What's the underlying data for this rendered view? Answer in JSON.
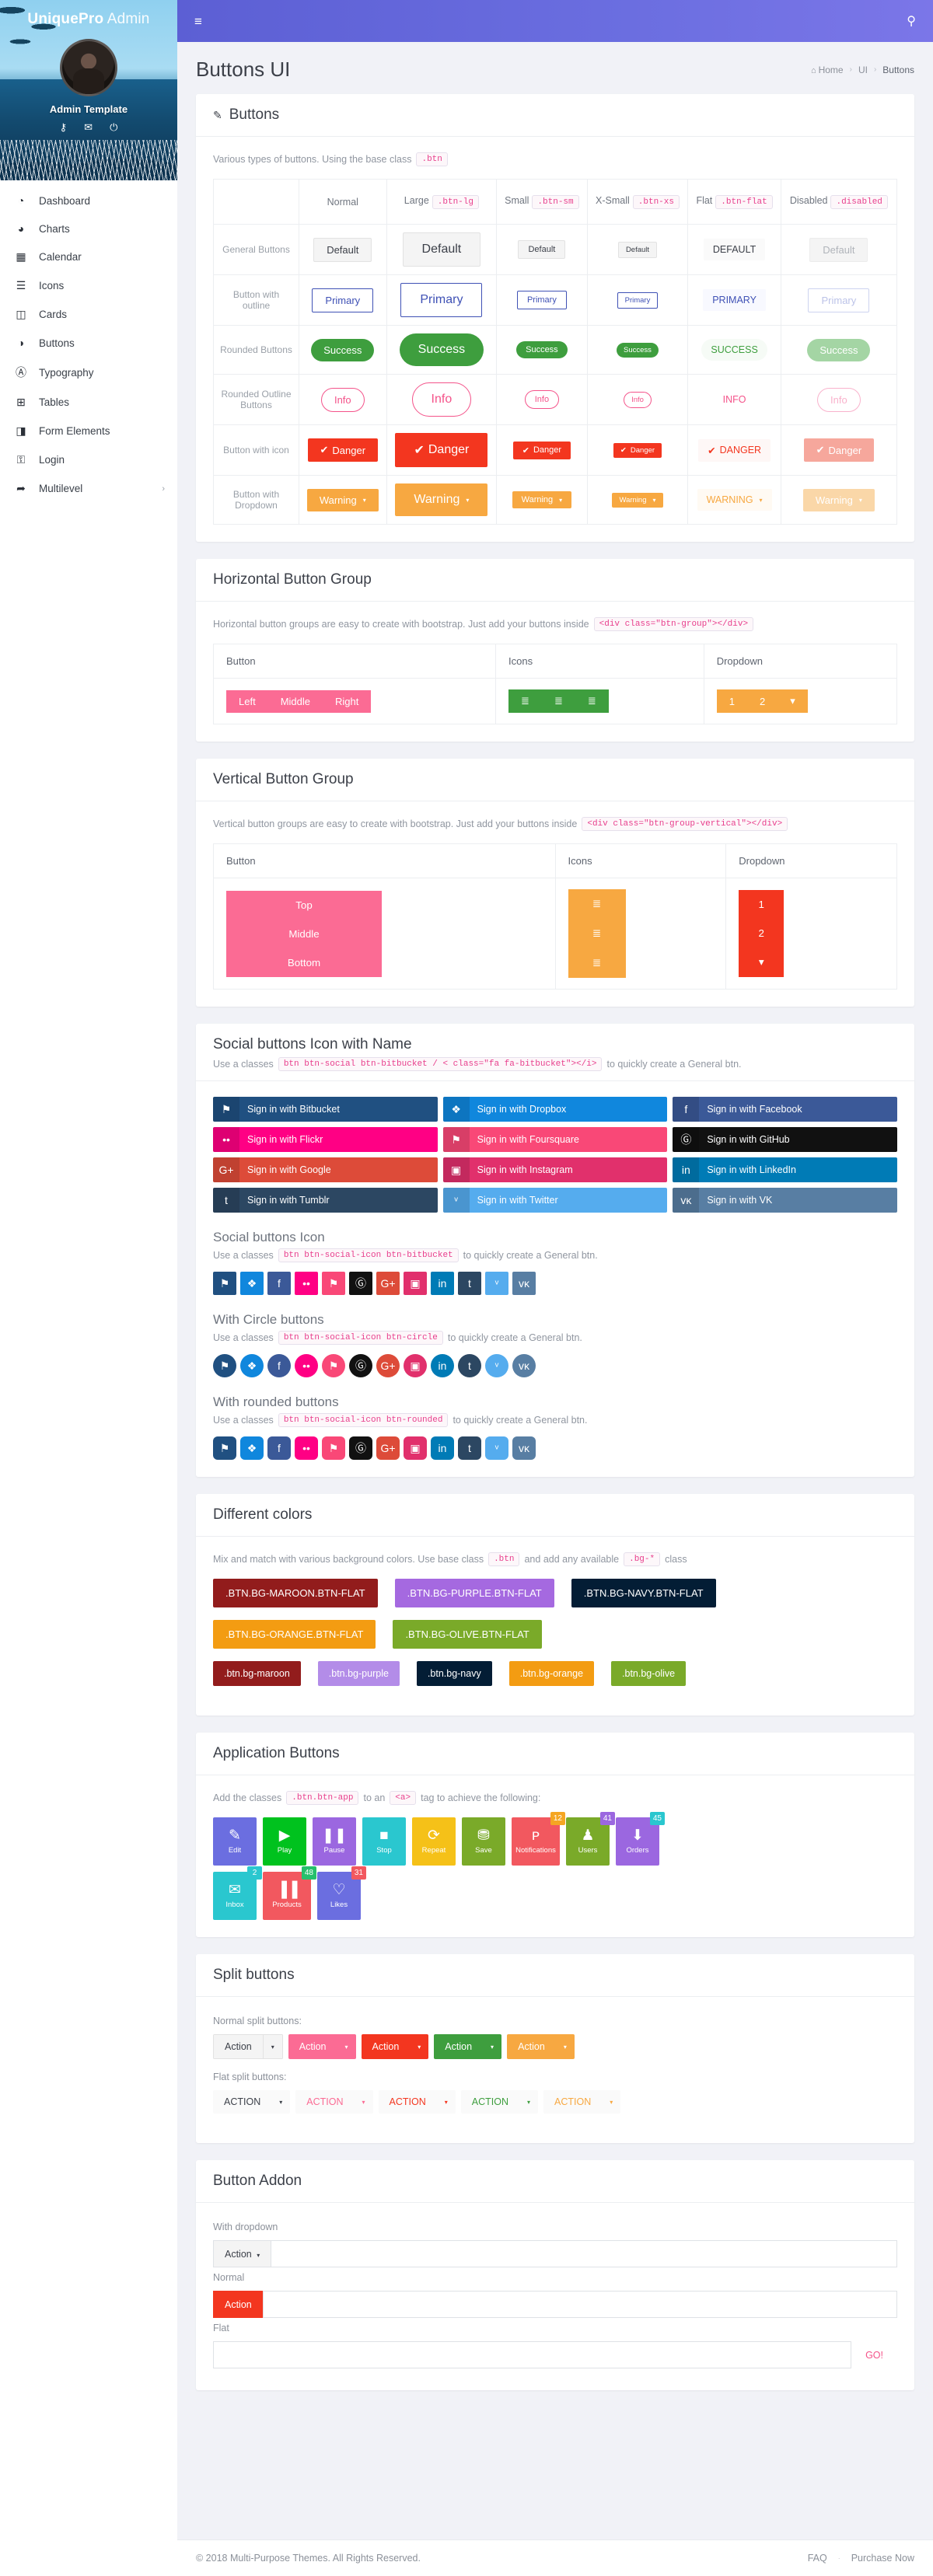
{
  "sidebar": {
    "brand_bold": "UniquePro",
    "brand_light": " Admin",
    "user_name": "Admin Template",
    "hero_icons": [
      {
        "name": "key-icon",
        "glyph": "⚷"
      },
      {
        "name": "mail-icon",
        "glyph": "✉"
      },
      {
        "name": "power-icon",
        "glyph": "⏻"
      }
    ],
    "items": [
      {
        "label": "Dashboard",
        "icon": "speedometer-icon",
        "glyph": "◔",
        "caret": ""
      },
      {
        "label": "Charts",
        "icon": "pie-chart-icon",
        "glyph": "◕",
        "caret": ""
      },
      {
        "label": "Calendar",
        "icon": "calendar-icon",
        "glyph": "▦",
        "caret": ""
      },
      {
        "label": "Icons",
        "icon": "list-icon",
        "glyph": "☰",
        "caret": ""
      },
      {
        "label": "Cards",
        "icon": "columns-icon",
        "glyph": "◫",
        "caret": ""
      },
      {
        "label": "Buttons",
        "icon": "contrast-icon",
        "glyph": "◑",
        "caret": ""
      },
      {
        "label": "Typography",
        "icon": "font-icon",
        "glyph": "Ⓐ",
        "caret": ""
      },
      {
        "label": "Tables",
        "icon": "table-icon",
        "glyph": "⊞",
        "caret": ""
      },
      {
        "label": "Form Elements",
        "icon": "file-icon",
        "glyph": "◨",
        "caret": ""
      },
      {
        "label": "Login",
        "icon": "lock-icon",
        "glyph": "⚿",
        "caret": ""
      },
      {
        "label": "Multilevel",
        "icon": "share-icon",
        "glyph": "➦",
        "caret": "›"
      }
    ]
  },
  "topbar": {
    "menu_icon": "hamburger-icon",
    "menu_glyph": "≡",
    "search_icon": "search-icon",
    "search_glyph": "⚲"
  },
  "page": {
    "title": "Buttons UI",
    "breadcrumb": {
      "home": "Home",
      "section": "UI",
      "current": "Buttons",
      "home_glyph": "⌂",
      "sep": "›"
    }
  },
  "buttons_card": {
    "title": "Buttons",
    "pen_glyph": "✎",
    "desc_before": "Various types of buttons. Using the base class",
    "desc_code": ".btn",
    "columns": [
      {
        "label": "Normal",
        "code": ""
      },
      {
        "label": "Large",
        "code": ".btn-lg"
      },
      {
        "label": "Small",
        "code": ".btn-sm"
      },
      {
        "label": "X-Small",
        "code": ".btn-xs"
      },
      {
        "label": "Flat",
        "code": ".btn-flat"
      },
      {
        "label": "Disabled",
        "code": ".disabled"
      }
    ],
    "rows": [
      {
        "label": "General Buttons",
        "text": "Default",
        "flat_text": "DEFAULT"
      },
      {
        "label": "Button with outline",
        "text": "Primary",
        "flat_text": "PRIMARY"
      },
      {
        "label": "Rounded Buttons",
        "text": "Success",
        "flat_text": "SUCCESS"
      },
      {
        "label": "Rounded Outline Buttons",
        "text": "Info",
        "flat_text": "INFO"
      },
      {
        "label": "Button with icon",
        "text": "Danger",
        "flat_text": "DANGER",
        "icon_glyph": "✔"
      },
      {
        "label": "Button with Dropdown",
        "text": "Warning",
        "flat_text": "WARNING",
        "caret": "▾"
      }
    ]
  },
  "hgroup_card": {
    "title": "Horizontal Button Group",
    "desc_before": "Horizontal button groups are easy to create with bootstrap. Just add your buttons inside",
    "desc_code": "<div class=\"btn-group\"></div>",
    "headers": [
      "Button",
      "Icons",
      "Dropdown"
    ],
    "buttons": [
      "Left",
      "Middle",
      "Right"
    ],
    "icons": [
      {
        "name": "align-left-icon",
        "glyph": "≣"
      },
      {
        "name": "align-center-icon",
        "glyph": "≣"
      },
      {
        "name": "align-right-icon",
        "glyph": "≣"
      }
    ],
    "dropdown": [
      "1",
      "2"
    ],
    "dropdown_caret": "▾"
  },
  "vgroup_card": {
    "title": "Vertical Button Group",
    "desc_before": "Vertical button groups are easy to create with bootstrap. Just add your buttons inside",
    "desc_code": "<div class=\"btn-group-vertical\"></div>",
    "headers": [
      "Button",
      "Icons",
      "Dropdown"
    ],
    "buttons": [
      "Top",
      "Middle",
      "Bottom"
    ],
    "icons": [
      {
        "name": "align-left-icon",
        "glyph": "≣"
      },
      {
        "name": "align-center-icon",
        "glyph": "≣"
      },
      {
        "name": "align-right-icon",
        "glyph": "≣"
      }
    ],
    "dropdown": [
      "1",
      "2"
    ],
    "dropdown_caret": "▾"
  },
  "social_named": {
    "title": "Social buttons Icon with Name",
    "desc_before": "Use a classes",
    "desc_code": "btn btn-social btn-bitbucket / < class=\"fa fa-bitbucket\"></i>",
    "desc_after": "to quickly create a General btn.",
    "items": [
      {
        "label": "Sign in with Bitbucket",
        "glyph": "⚑",
        "icon": "bitbucket-icon",
        "color": "#205081"
      },
      {
        "label": "Sign in with Dropbox",
        "glyph": "❖",
        "icon": "dropbox-icon",
        "color": "#1087dd"
      },
      {
        "label": "Sign in with Facebook",
        "glyph": "f",
        "icon": "facebook-icon",
        "color": "#3b5998"
      },
      {
        "label": "Sign in with Flickr",
        "glyph": "••",
        "icon": "flickr-icon",
        "color": "#ff0084"
      },
      {
        "label": "Sign in with Foursquare",
        "glyph": "⚑",
        "icon": "foursquare-icon",
        "color": "#f94877"
      },
      {
        "label": "Sign in with GitHub",
        "glyph": "Ⓖ",
        "icon": "github-icon",
        "color": "#111111"
      },
      {
        "label": "Sign in with Google",
        "glyph": "G+",
        "icon": "google-plus-icon",
        "color": "#dd4b39"
      },
      {
        "label": "Sign in with Instagram",
        "glyph": "▣",
        "icon": "instagram-icon",
        "color": "#e1306c"
      },
      {
        "label": "Sign in with LinkedIn",
        "glyph": "in",
        "icon": "linkedin-icon",
        "color": "#007bb6"
      },
      {
        "label": "Sign in with Tumblr",
        "glyph": "t",
        "icon": "tumblr-icon",
        "color": "#2c4762"
      },
      {
        "label": "Sign in with Twitter",
        "glyph": "ᵛ",
        "icon": "twitter-icon",
        "color": "#55acee"
      },
      {
        "label": "Sign in with VK",
        "glyph": "ᴠᴋ",
        "icon": "vk-icon",
        "color": "#587ea3"
      }
    ]
  },
  "social_icon": {
    "title": "Social buttons Icon",
    "desc_before": "Use a classes",
    "desc_code": "btn btn-social-icon btn-bitbucket",
    "desc_after": "to quickly create a General btn."
  },
  "social_circle": {
    "title": "With Circle buttons",
    "desc_before": "Use a classes",
    "desc_code": "btn btn-social-icon btn-circle",
    "desc_after": "to quickly create a General btn."
  },
  "social_rounded": {
    "title": "With rounded buttons",
    "desc_before": "Use a classes",
    "desc_code": "btn btn-social-icon btn-rounded",
    "desc_after": "to quickly create a General btn."
  },
  "colors_card": {
    "title": "Different colors",
    "desc_before": "Mix and match with various background colors. Use base class",
    "desc_code1": ".btn",
    "desc_mid": "and add any available",
    "desc_code2": ".bg-*",
    "desc_after": "class",
    "flat_buttons": [
      {
        "label": ".BTN.BG-MAROON.BTN-FLAT",
        "color": "#921c1c"
      },
      {
        "label": ".BTN.BG-PURPLE.BTN-FLAT",
        "color": "#a569e0"
      },
      {
        "label": ".BTN.BG-NAVY.BTN-FLAT",
        "color": "#031d35"
      },
      {
        "label": ".BTN.BG-ORANGE.BTN-FLAT",
        "color": "#f39c12"
      },
      {
        "label": ".BTN.BG-OLIVE.BTN-FLAT",
        "color": "#7aaa29"
      }
    ],
    "solid_buttons": [
      {
        "label": ".btn.bg-maroon",
        "color": "#921c1c"
      },
      {
        "label": ".btn.bg-purple",
        "color": "#b38ce8"
      },
      {
        "label": ".btn.bg-navy",
        "color": "#031d35"
      },
      {
        "label": ".btn.bg-orange",
        "color": "#f39c12"
      },
      {
        "label": ".btn.bg-olive",
        "color": "#7aaa29"
      }
    ]
  },
  "app_card": {
    "title": "Application Buttons",
    "desc_before": "Add the classes",
    "desc_code1": ".btn.btn-app",
    "desc_mid": "to an",
    "desc_code2": "<a>",
    "desc_after": "tag to achieve the following:",
    "items": [
      {
        "label": "Edit",
        "icon": "edit-icon",
        "glyph": "✎",
        "color": "#6b6ee0",
        "badge": "",
        "badge_color": ""
      },
      {
        "label": "Play",
        "icon": "play-icon",
        "glyph": "▶",
        "color": "#00c21e",
        "badge": "",
        "badge_color": ""
      },
      {
        "label": "Pause",
        "icon": "pause-icon",
        "glyph": "❚❚",
        "color": "#9b67e0",
        "badge": "",
        "badge_color": ""
      },
      {
        "label": "Stop",
        "icon": "stop-icon",
        "glyph": "■",
        "color": "#2ac7cf",
        "badge": "",
        "badge_color": ""
      },
      {
        "label": "Repeat",
        "icon": "repeat-icon",
        "glyph": "⟳",
        "color": "#f5c118",
        "badge": "",
        "badge_color": ""
      },
      {
        "label": "Save",
        "icon": "save-icon",
        "glyph": "⛃",
        "color": "#7aaa29",
        "badge": "",
        "badge_color": ""
      },
      {
        "label": "Notifications",
        "icon": "megaphone-icon",
        "glyph": "ᴘ",
        "color": "#f2585f",
        "badge": "12",
        "badge_color": "#f5a623"
      },
      {
        "label": "Users",
        "icon": "users-icon",
        "glyph": "♟",
        "color": "#7aaa29",
        "badge": "41",
        "badge_color": "#9b67e0"
      },
      {
        "label": "Orders",
        "icon": "inbox-icon",
        "glyph": "⬇",
        "color": "#9b67e0",
        "badge": "45",
        "badge_color": "#2ac7cf"
      },
      {
        "label": "Inbox",
        "icon": "mail-icon",
        "glyph": "✉",
        "color": "#2ac7cf",
        "badge": "2",
        "badge_color": "#2ac7cf"
      },
      {
        "label": "Products",
        "icon": "barcode-icon",
        "glyph": "▐▐",
        "color": "#f2585f",
        "badge": "48",
        "badge_color": "#26c06c"
      },
      {
        "label": "Likes",
        "icon": "heart-icon",
        "glyph": "♡",
        "color": "#6b6ee0",
        "badge": "31",
        "badge_color": "#f2585f"
      }
    ]
  },
  "split_card": {
    "title": "Split buttons",
    "normal_label": "Normal split buttons:",
    "flat_label": "Flat split buttons:",
    "normal_text": "Action",
    "flat_text": "ACTION",
    "caret": "▾",
    "colors": [
      "#f4f4f4",
      "#fb6b94",
      "#f3361f",
      "#3e9e3e",
      "#f7a841"
    ],
    "flat_colors": [
      "#3c4049",
      "#fb6b94",
      "#f3361f",
      "#3e9e3e",
      "#f7a841"
    ]
  },
  "addon_card": {
    "title": "Button Addon",
    "dropdown_label": "With dropdown",
    "dropdown_btn": "Action",
    "dropdown_caret": "▾",
    "normal_label": "Normal",
    "normal_btn": "Action",
    "flat_label": "Flat",
    "flat_btn": "GO!",
    "input_value": ""
  },
  "footer": {
    "copyright": "© 2018 Multi-Purpose Themes. All Rights Reserved.",
    "links": [
      "FAQ",
      "Purchase Now"
    ],
    "dot": "·"
  },
  "social_colors": [
    {
      "icon": "bitbucket-icon",
      "glyph": "⚑",
      "color": "#205081"
    },
    {
      "icon": "dropbox-icon",
      "glyph": "❖",
      "color": "#1087dd"
    },
    {
      "icon": "facebook-icon",
      "glyph": "f",
      "color": "#3b5998"
    },
    {
      "icon": "flickr-icon",
      "glyph": "••",
      "color": "#ff0084"
    },
    {
      "icon": "foursquare-icon",
      "glyph": "⚑",
      "color": "#f94877"
    },
    {
      "icon": "github-icon",
      "glyph": "Ⓖ",
      "color": "#111111"
    },
    {
      "icon": "google-plus-icon",
      "glyph": "G+",
      "color": "#dd4b39"
    },
    {
      "icon": "instagram-icon",
      "glyph": "▣",
      "color": "#e1306c"
    },
    {
      "icon": "linkedin-icon",
      "glyph": "in",
      "color": "#007bb6"
    },
    {
      "icon": "tumblr-icon",
      "glyph": "t",
      "color": "#2c4762"
    },
    {
      "icon": "twitter-icon",
      "glyph": "ᵛ",
      "color": "#55acee"
    },
    {
      "icon": "vk-icon",
      "glyph": "ᴠᴋ",
      "color": "#587ea3"
    }
  ]
}
